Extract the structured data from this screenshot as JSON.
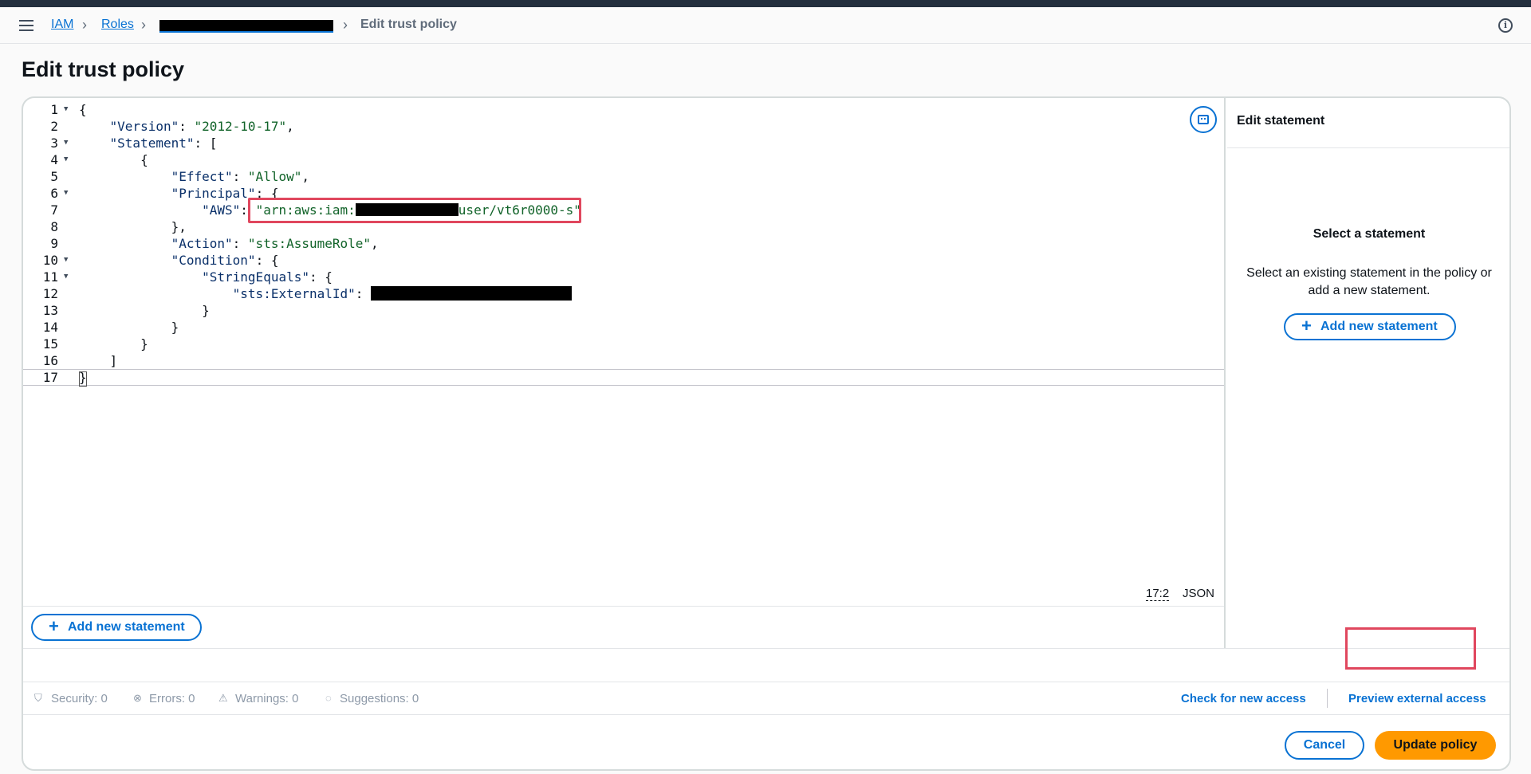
{
  "breadcrumb": {
    "items": [
      "IAM",
      "Roles"
    ],
    "current": "Edit trust policy"
  },
  "page": {
    "title": "Edit trust policy"
  },
  "editor": {
    "lines": [
      {
        "n": "1",
        "fold": true
      },
      {
        "n": "2",
        "fold": false
      },
      {
        "n": "3",
        "fold": true
      },
      {
        "n": "4",
        "fold": true
      },
      {
        "n": "5",
        "fold": false
      },
      {
        "n": "6",
        "fold": true
      },
      {
        "n": "7",
        "fold": false
      },
      {
        "n": "8",
        "fold": false
      },
      {
        "n": "9",
        "fold": false
      },
      {
        "n": "10",
        "fold": true
      },
      {
        "n": "11",
        "fold": true
      },
      {
        "n": "12",
        "fold": false
      },
      {
        "n": "13",
        "fold": false
      },
      {
        "n": "14",
        "fold": false
      },
      {
        "n": "15",
        "fold": false
      },
      {
        "n": "16",
        "fold": false
      },
      {
        "n": "17",
        "fold": false
      }
    ],
    "code": {
      "version_key": "\"Version\"",
      "version_val": "\"2012-10-17\"",
      "statement_key": "\"Statement\"",
      "effect_key": "\"Effect\"",
      "effect_val": "\"Allow\"",
      "principal_key": "\"Principal\"",
      "aws_key": "\"AWS\"",
      "arn_prefix": "\"arn:aws:iam:",
      "arn_suffix": "user/vt6r0000-s\"",
      "action_key": "\"Action\"",
      "action_val": "\"sts:AssumeRole\"",
      "condition_key": "\"Condition\"",
      "stringequals_key": "\"StringEquals\"",
      "externalid_key": "\"sts:ExternalId\""
    },
    "cursor_position": "17:2",
    "language": "JSON",
    "add_statement_label": "Add new statement"
  },
  "side_panel": {
    "title": "Edit statement",
    "empty_title": "Select a statement",
    "empty_desc": "Select an existing statement in the policy or add a new statement.",
    "add_statement_label": "Add new statement"
  },
  "validation": {
    "security": "Security: 0",
    "errors": "Errors: 0",
    "warnings": "Warnings: 0",
    "suggestions": "Suggestions: 0",
    "check_access": "Check for new access",
    "preview_access": "Preview external access"
  },
  "footer": {
    "cancel": "Cancel",
    "update": "Update policy"
  },
  "colors": {
    "accent": "#0972d3",
    "primary_button": "#ff9900",
    "highlight": "#e0475e",
    "topbar": "#232f3e"
  }
}
